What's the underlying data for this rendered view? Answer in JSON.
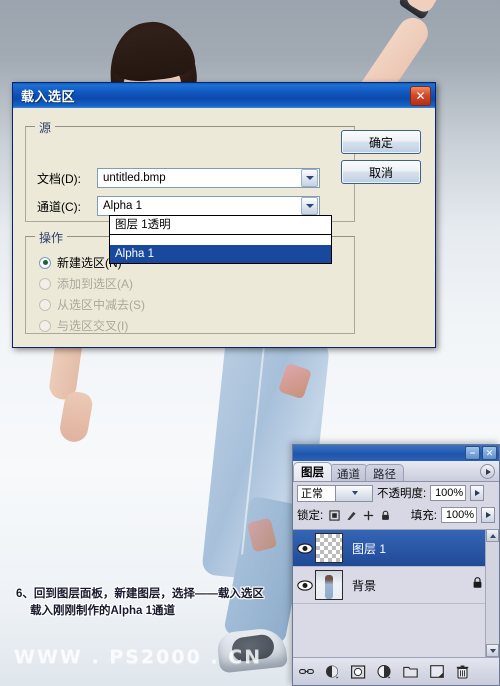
{
  "dialog": {
    "title": "载入选区",
    "close_label": "✕",
    "source_group_label": "源",
    "document_label": "文档(D):",
    "document_value": "untitled.bmp",
    "channel_label": "通道(C):",
    "channel_value": "Alpha 1",
    "dropdown_options": [
      "图层 1透明",
      "",
      "Alpha 1"
    ],
    "dropdown_selected": "Alpha 1",
    "operation_group_label": "操作",
    "operations": [
      {
        "label": "新建选区(N)",
        "selected": true,
        "disabled": false
      },
      {
        "label": "添加到选区(A)",
        "selected": false,
        "disabled": true
      },
      {
        "label": "从选区中减去(S)",
        "selected": false,
        "disabled": true
      },
      {
        "label": "与选区交叉(I)",
        "selected": false,
        "disabled": true
      }
    ],
    "ok_label": "确定",
    "cancel_label": "取消"
  },
  "panel": {
    "minimize_label": "−",
    "close_label": "✕",
    "tabs": [
      {
        "label": "图层",
        "active": true
      },
      {
        "label": "通道",
        "active": false
      },
      {
        "label": "路径",
        "active": false
      }
    ],
    "blend_mode": "正常",
    "opacity_label": "不透明度:",
    "opacity_value": "100%",
    "lock_label": "锁定:",
    "fill_label": "填充:",
    "fill_value": "100%",
    "layers": [
      {
        "name": "图层 1",
        "selected": true,
        "locked": false,
        "type": "transparent"
      },
      {
        "name": "背景",
        "selected": false,
        "locked": true,
        "type": "photo"
      }
    ],
    "footer_icons": [
      "link-icon",
      "layer-style-icon",
      "layer-mask-icon",
      "adjustment-layer-icon",
      "new-group-icon",
      "new-layer-icon",
      "delete-layer-icon"
    ]
  },
  "caption": {
    "line1": "6、回到图层面板，新建图层，选择——载入选区",
    "line2": "载入刚刚制作的Alpha 1通道"
  },
  "watermark": {
    "text": "WWW . PS2000 . CN"
  },
  "colors": {
    "titlebar_blue": "#1257bf",
    "selection_blue": "#18499c",
    "dialog_face": "#ece9d8",
    "panel_face": "#d7d8e4",
    "close_red": "#d4492a"
  }
}
